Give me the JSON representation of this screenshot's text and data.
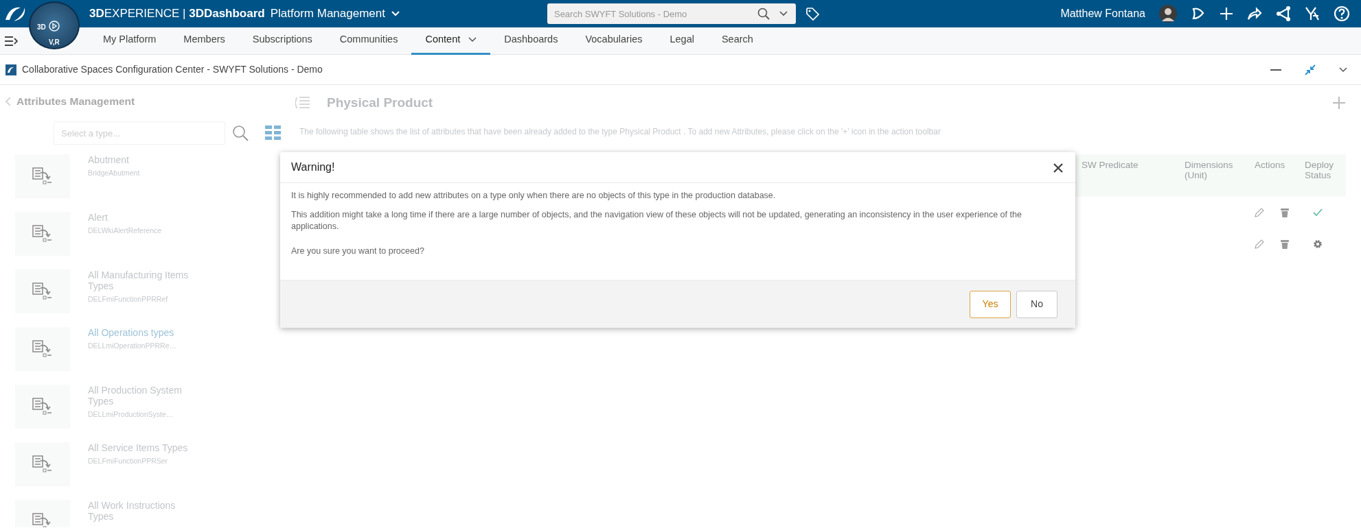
{
  "topbar": {
    "compass_labels": [
      "3D",
      "V,R"
    ],
    "brand": "**3D**EXPERIENCE | **3DDashboard**",
    "app": "Platform Management",
    "search": {
      "placeholder": "Search SWYFT Solutions - Demo"
    },
    "user": "Matthew Fontana"
  },
  "nav": {
    "tabs": [
      {
        "label": "My Platform",
        "selected": false,
        "dropdown": false
      },
      {
        "label": "Members",
        "selected": false,
        "dropdown": false
      },
      {
        "label": "Subscriptions",
        "selected": false,
        "dropdown": false
      },
      {
        "label": "Communities",
        "selected": false,
        "dropdown": false
      },
      {
        "label": "Content",
        "selected": true,
        "dropdown": true
      },
      {
        "label": "Dashboards",
        "selected": false,
        "dropdown": false
      },
      {
        "label": "Vocabularies",
        "selected": false,
        "dropdown": false
      },
      {
        "label": "Legal",
        "selected": false,
        "dropdown": false
      },
      {
        "label": "Search",
        "selected": false,
        "dropdown": false
      }
    ]
  },
  "widget": {
    "title": "Collaborative Spaces Configuration Center - SWYFT Solutions - Demo"
  },
  "sidebar": {
    "back": "Attributes Management",
    "search": {
      "placeholder": "Select a type..."
    },
    "items": [
      {
        "title": "Abutment",
        "subtitle": "BridgeAbutment",
        "selected": false
      },
      {
        "title": "Alert",
        "subtitle": "DELWkiAlertReference",
        "selected": false
      },
      {
        "title": "All Manufacturing Items Types",
        "subtitle": "DELFmiFunctionPPRRef",
        "selected": false
      },
      {
        "title": "All Operations types",
        "subtitle": "DELLmiOperationPPRRe…",
        "selected": true
      },
      {
        "title": "All Production System Types",
        "subtitle": "DELLmiProductionSyste…",
        "selected": false
      },
      {
        "title": "All Service Items Types",
        "subtitle": "DELFmiFunctionPPRSer",
        "selected": false
      },
      {
        "title": "All Work Instructions Types",
        "selected": false
      }
    ]
  },
  "main": {
    "title": "Physical Product",
    "description": "The following table shows the list of attributes that have been already added to the type  Physical Product . To add new Attributes, please click on the '+' icon in the action toolbar",
    "table": {
      "columns": [
        "SW Predicate",
        "Dimensions (Unit)",
        "Actions",
        "Deploy Status"
      ],
      "rows": [
        {
          "kind": "deployed"
        },
        {
          "kind": "pending"
        }
      ]
    }
  },
  "dialog": {
    "title": "Warning!",
    "paragraphs": [
      "It is highly recommended to add new attributes on a type only when there are no objects of this type in the production database.",
      "This addition might take a long time if there are a large number of objects, and the navigation view of these objects will not be updated, generating an inconsistency in the user experience of the applications.",
      "Are you sure you want to proceed?"
    ],
    "buttons": [
      {
        "label": "Yes",
        "kind": "primary"
      },
      {
        "label": "No",
        "kind": "secondary"
      }
    ]
  }
}
